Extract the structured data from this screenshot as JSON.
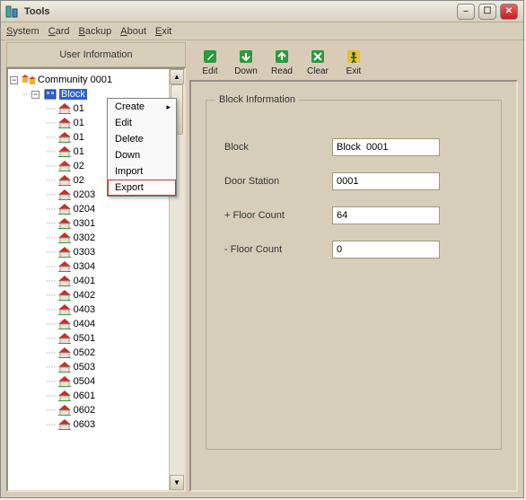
{
  "window": {
    "title": "Tools"
  },
  "menubar": {
    "items": [
      "System",
      "Card",
      "Backup",
      "About",
      "Exit"
    ]
  },
  "left": {
    "header": "User Information",
    "community": "Community 0001",
    "selected_block": "Block",
    "tree_items": [
      "01",
      "01",
      "01",
      "01",
      "02",
      "02",
      "0203",
      "0204",
      "0301",
      "0302",
      "0303",
      "0304",
      "0401",
      "0402",
      "0403",
      "0404",
      "0501",
      "0502",
      "0503",
      "0504",
      "0601",
      "0602",
      "0603"
    ]
  },
  "context_menu": {
    "items": [
      "Create",
      "Edit",
      "Delete",
      "Down",
      "Import",
      "Export"
    ],
    "highlight_index": 5,
    "submenu_index": 0
  },
  "toolbar": {
    "buttons": [
      {
        "name": "edit-button",
        "label": "Edit",
        "color": "#2a9a3a"
      },
      {
        "name": "down-button",
        "label": "Down",
        "color": "#2a9a3a"
      },
      {
        "name": "read-button",
        "label": "Read",
        "color": "#2a9a3a"
      },
      {
        "name": "clear-button",
        "label": "Clear",
        "color": "#2a9a3a"
      },
      {
        "name": "exit-button",
        "label": "Exit",
        "color": "#e8c030"
      }
    ]
  },
  "form": {
    "title": "Block Information",
    "fields": {
      "block": {
        "label": "Block",
        "value": "Block  0001"
      },
      "door": {
        "label": "Door Station",
        "value": "0001"
      },
      "plus_floor": {
        "label": "+ Floor Count",
        "value": "64"
      },
      "minus_floor": {
        "label": "- Floor Count",
        "value": "0"
      }
    }
  }
}
